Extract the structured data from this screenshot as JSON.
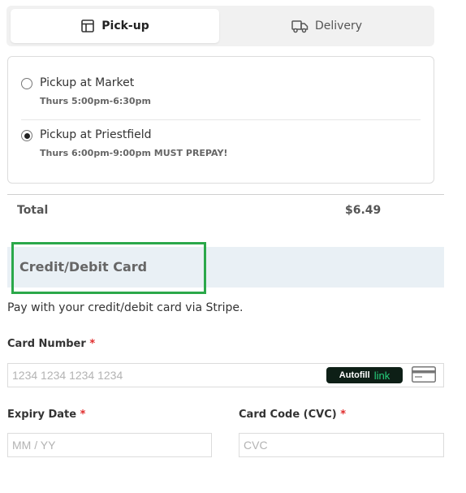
{
  "tabs": {
    "pickup": {
      "label": "Pick-up",
      "icon": "store-icon",
      "active": true
    },
    "delivery": {
      "label": "Delivery",
      "icon": "truck-icon",
      "active": false
    }
  },
  "pickup_options": [
    {
      "title": "Pickup at Market",
      "schedule": "Thurs 5:00pm-6:30pm",
      "selected": false
    },
    {
      "title": "Pickup at Priestfield",
      "schedule": "Thurs 6:00pm-9:00pm MUST PREPAY!",
      "selected": true
    }
  ],
  "total": {
    "label": "Total",
    "value": "$6.49"
  },
  "payment": {
    "method_title": "Credit/Debit Card",
    "description": "Pay with your credit/debit card via Stripe.",
    "highlight_color": "#2ba84a"
  },
  "fields": {
    "card_number": {
      "label": "Card Number",
      "required_mark": "*",
      "placeholder": "1234 1234 1234 1234"
    },
    "expiry": {
      "label": "Expiry Date",
      "required_mark": "*",
      "placeholder": "MM / YY"
    },
    "cvc": {
      "label": "Card Code (CVC)",
      "required_mark": "*",
      "placeholder": "CVC"
    }
  },
  "autofill": {
    "text": "Autofill",
    "brand": "link",
    "brand_color": "#26d07c"
  },
  "icons": {
    "card": "credit-card-icon"
  }
}
